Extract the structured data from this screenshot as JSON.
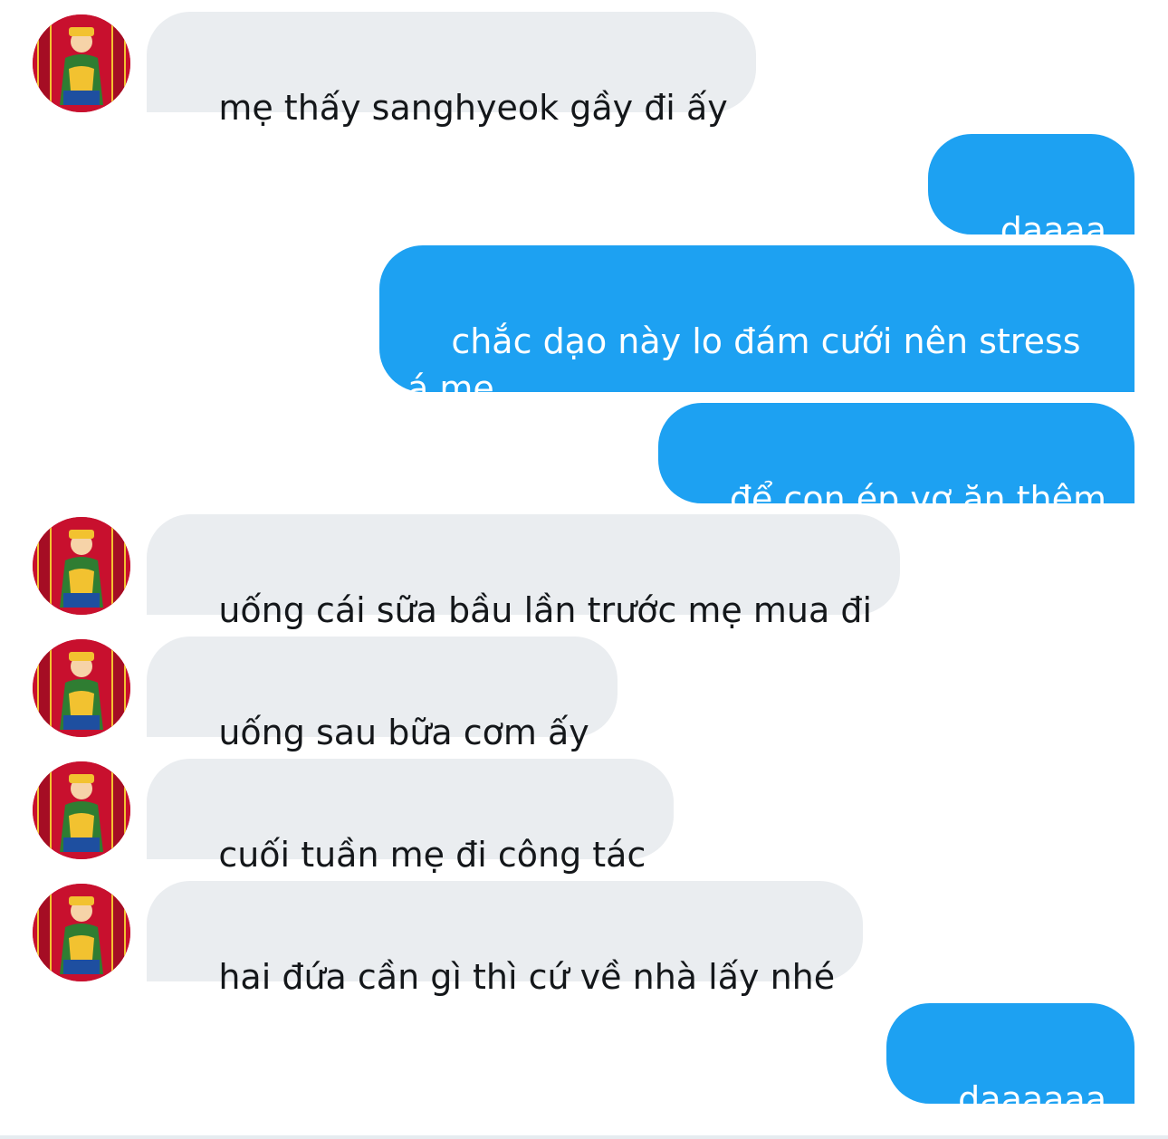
{
  "conversation": {
    "messages": [
      {
        "direction": "incoming",
        "text": "mẹ thấy sanghyeok gầy đi ấy",
        "avatar_icon": "god-of-wealth-avatar-icon"
      },
      {
        "direction": "outgoing",
        "text": "dạaaa"
      },
      {
        "direction": "outgoing",
        "text": "chắc dạo này lo đám cưới nên stress á mẹ"
      },
      {
        "direction": "outgoing",
        "text": "để con ép vợ ăn thêm"
      },
      {
        "direction": "incoming",
        "text": "uống cái sữa bầu lần trước mẹ mua đi",
        "avatar_icon": "god-of-wealth-avatar-icon"
      },
      {
        "direction": "incoming",
        "text": "uống sau bữa cơm ấy",
        "avatar_icon": "god-of-wealth-avatar-icon"
      },
      {
        "direction": "incoming",
        "text": "cuối tuần mẹ đi công tác",
        "avatar_icon": "god-of-wealth-avatar-icon"
      },
      {
        "direction": "incoming",
        "text": "hai đứa cần gì thì cứ về nhà lấy nhé",
        "avatar_icon": "god-of-wealth-avatar-icon"
      },
      {
        "direction": "outgoing",
        "text": "dạaaaaa"
      }
    ]
  },
  "colors": {
    "incoming_bubble": "#eaedf0",
    "incoming_text": "#14171a",
    "outgoing_bubble": "#1da1f2",
    "outgoing_text": "#ffffff",
    "avatar_red": "#c8102e",
    "avatar_gold": "#f2c230"
  }
}
